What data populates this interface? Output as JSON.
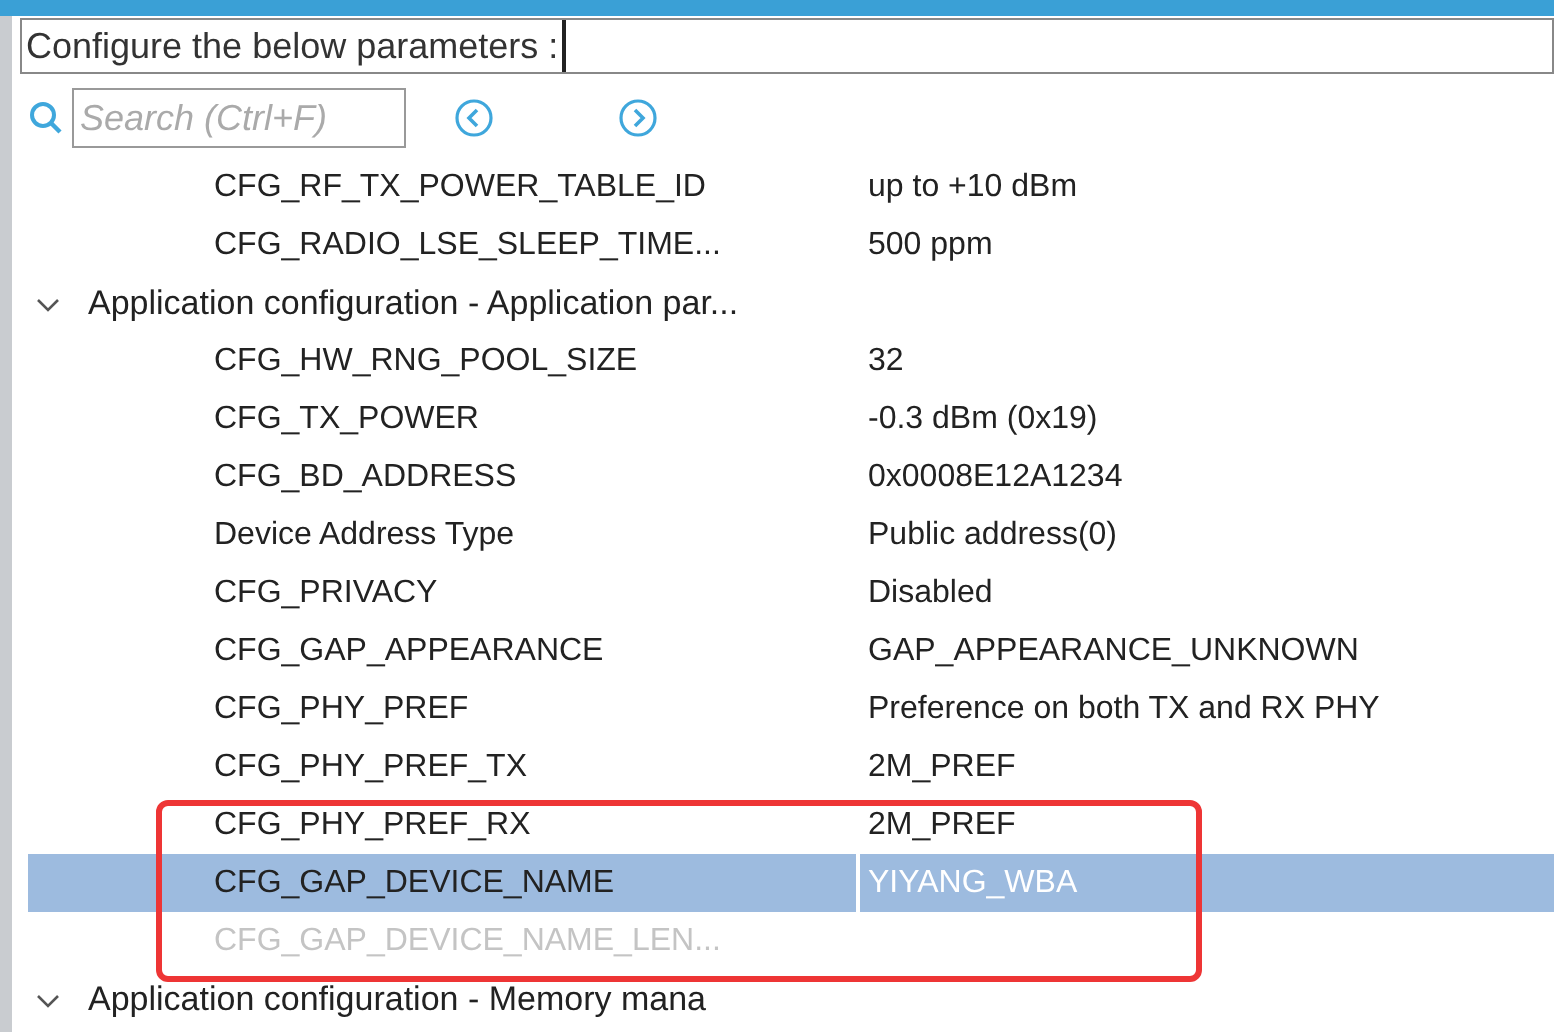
{
  "header": {
    "label": "Configure the below parameters :"
  },
  "search": {
    "placeholder": "Search (Ctrl+F)"
  },
  "highlight": {
    "color": "#ee3535"
  },
  "rows": [
    {
      "kind": "param",
      "name": "CFG_RF_TX_POWER_TABLE_ID",
      "value": "up to +10 dBm",
      "selected": false,
      "disabled": false
    },
    {
      "kind": "param",
      "name": "CFG_RADIO_LSE_SLEEP_TIME...",
      "value": "500 ppm",
      "selected": false,
      "disabled": false
    },
    {
      "kind": "group",
      "name": "Application configuration - Application par...",
      "expanded": true
    },
    {
      "kind": "param",
      "name": "CFG_HW_RNG_POOL_SIZE",
      "value": "32",
      "selected": false,
      "disabled": false
    },
    {
      "kind": "param",
      "name": "CFG_TX_POWER",
      "value": "-0.3 dBm (0x19)",
      "selected": false,
      "disabled": false
    },
    {
      "kind": "param",
      "name": "CFG_BD_ADDRESS",
      "value": "0x0008E12A1234",
      "selected": false,
      "disabled": false
    },
    {
      "kind": "param",
      "name": "Device Address Type",
      "value": "Public address(0)",
      "selected": false,
      "disabled": false
    },
    {
      "kind": "param",
      "name": "CFG_PRIVACY",
      "value": "Disabled",
      "selected": false,
      "disabled": false
    },
    {
      "kind": "param",
      "name": "CFG_GAP_APPEARANCE",
      "value": "GAP_APPEARANCE_UNKNOWN",
      "selected": false,
      "disabled": false
    },
    {
      "kind": "param",
      "name": "CFG_PHY_PREF",
      "value": "Preference on both TX and RX PHY",
      "selected": false,
      "disabled": false
    },
    {
      "kind": "param",
      "name": "CFG_PHY_PREF_TX",
      "value": "2M_PREF",
      "selected": false,
      "disabled": false
    },
    {
      "kind": "param",
      "name": "CFG_PHY_PREF_RX",
      "value": "2M_PREF",
      "selected": false,
      "disabled": false,
      "highlighted": true
    },
    {
      "kind": "param",
      "name": "CFG_GAP_DEVICE_NAME",
      "value": "YIYANG_WBA",
      "selected": true,
      "disabled": false,
      "highlighted": true
    },
    {
      "kind": "param",
      "name": "CFG_GAP_DEVICE_NAME_LEN...",
      "selected": false,
      "disabled": true,
      "highlighted": true
    },
    {
      "kind": "group",
      "name": "Application configuration - Memory mana",
      "expanded": true
    }
  ]
}
